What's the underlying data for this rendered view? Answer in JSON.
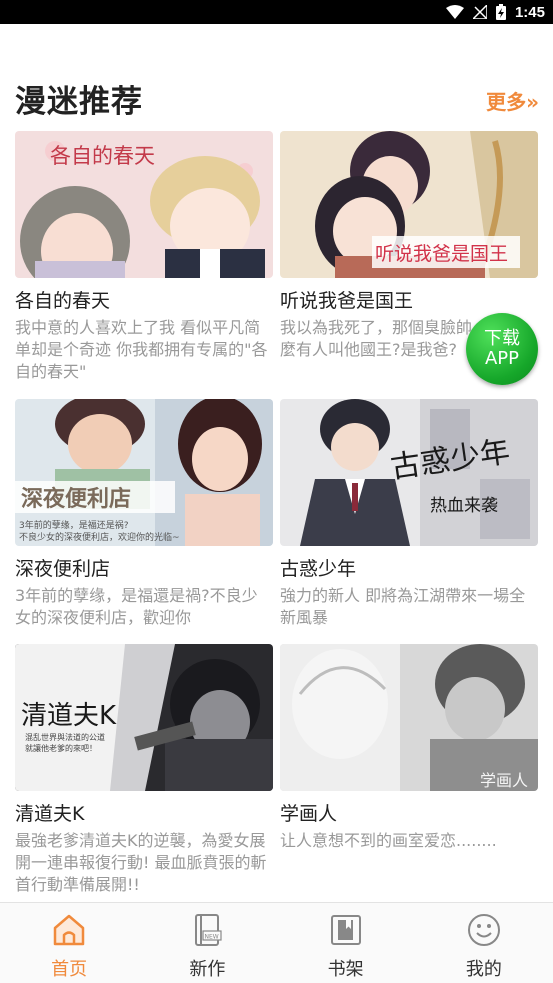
{
  "status_bar": {
    "time": "1:45",
    "battery_icon": "battery-charging-icon",
    "wifi_icon": "wifi-icon",
    "signal_icon": "no-signal-icon"
  },
  "header": {
    "title": "漫迷推荐",
    "more_label": "更多»"
  },
  "colors": {
    "accent": "#f08a3c",
    "fab_green": "#1fb52f"
  },
  "comics": [
    {
      "title": "各自的春天",
      "description": "我中意的人喜欢上了我 看似平凡简单却是个奇迹 你我都拥有专属的\"各自的春天\"",
      "cover_text": "各自的春天"
    },
    {
      "title": "听说我爸是国王",
      "description": "我以為我死了，那個臭臉帥....咦怎麼有人叫他國王?是我爸?",
      "cover_text": "听说我爸是国王"
    },
    {
      "title": "深夜便利店",
      "description": "3年前的孽缘，是福還是禍?不良少女的深夜便利店，歡迎你",
      "cover_text": "深夜便利店",
      "cover_caption_1": "3年前的孽缘，是福还是祸?",
      "cover_caption_2": "不良少女的深夜便利店，欢迎你的光临~"
    },
    {
      "title": "古惑少年",
      "description": "強力的新人 即將為江湖帶來一場全新風暴",
      "cover_text": "古惑少年",
      "cover_caption": "热血来袭"
    },
    {
      "title": "清道夫K",
      "description": "最強老爹清道夫K的逆襲，為愛女展開一連串報復行動! 最血脈賁張的斬首行動準備展開!!",
      "cover_text": "清道夫K",
      "cover_caption_1": "混乱世界與法道的公道",
      "cover_caption_2": "就讓他老爹的來吧！"
    },
    {
      "title": "学画人",
      "description": "让人意想不到的画室爱恋........",
      "cover_text": "学画人"
    }
  ],
  "fab": {
    "line1": "下载",
    "line2": "APP"
  },
  "tabs": [
    {
      "label": "首页",
      "icon": "home-icon",
      "active": true
    },
    {
      "label": "新作",
      "icon": "new-book-icon",
      "active": false
    },
    {
      "label": "书架",
      "icon": "bookshelf-icon",
      "active": false
    },
    {
      "label": "我的",
      "icon": "smiley-profile-icon",
      "active": false
    }
  ]
}
